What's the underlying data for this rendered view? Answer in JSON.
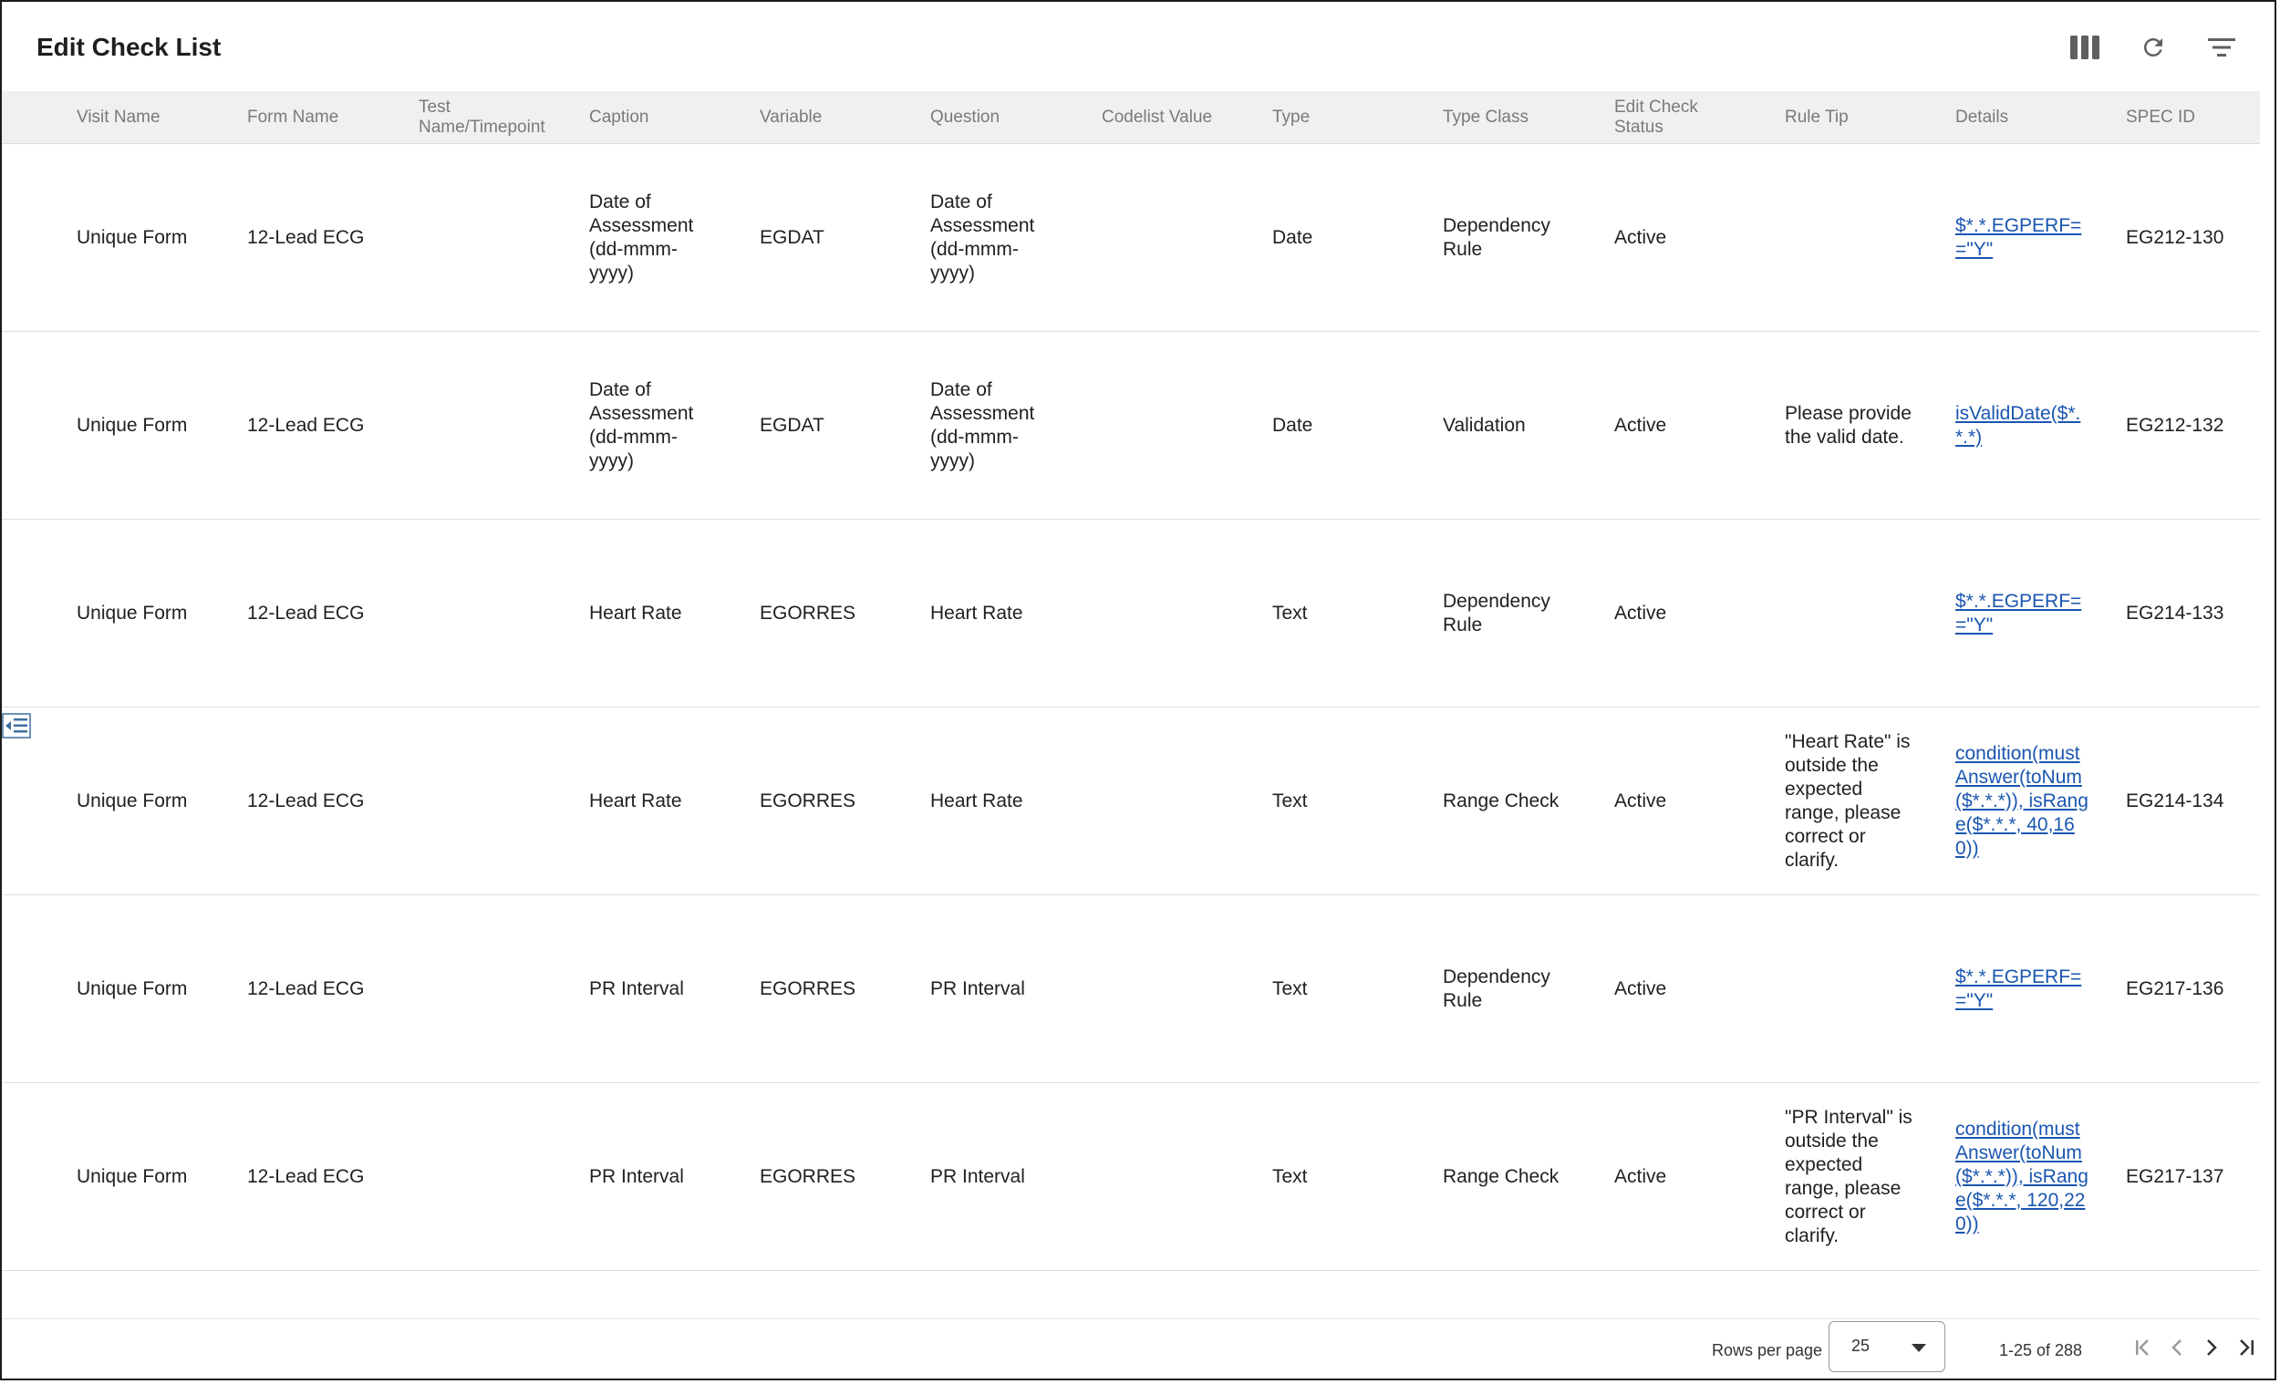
{
  "header": {
    "title": "Edit Check List"
  },
  "toolbar": {
    "columns_icon": "columns-icon",
    "refresh_icon": "refresh-icon",
    "filter_icon": "filter-icon"
  },
  "table": {
    "columns": [
      "Visit Name",
      "Form Name",
      "Test Name/Timepoint",
      "Caption",
      "Variable",
      "Question",
      "Codelist Value",
      "Type",
      "Type Class",
      "Edit Check Status",
      "Rule Tip",
      "Details",
      "SPEC ID"
    ],
    "rows": [
      {
        "visit_name": "Unique Form",
        "form_name": "12-Lead ECG",
        "test_name": "",
        "caption": "Date of Assessment (dd-mmm-yyyy)",
        "variable": "EGDAT",
        "question": "Date of Assessment (dd-mmm-yyyy)",
        "codelist_value": "",
        "type": "Date",
        "type_class": "Dependency Rule",
        "status": "Active",
        "rule_tip": "",
        "details": "$*.*.EGPERF==\"Y\"",
        "spec_id": "EG212-130"
      },
      {
        "visit_name": "Unique Form",
        "form_name": "12-Lead ECG",
        "test_name": "",
        "caption": "Date of Assessment (dd-mmm-yyyy)",
        "variable": "EGDAT",
        "question": "Date of Assessment (dd-mmm-yyyy)",
        "codelist_value": "",
        "type": "Date",
        "type_class": "Validation",
        "status": "Active",
        "rule_tip": "Please provide the valid date.",
        "details": "isValidDate($*.*.*)",
        "spec_id": "EG212-132"
      },
      {
        "visit_name": "Unique Form",
        "form_name": "12-Lead ECG",
        "test_name": "",
        "caption": "Heart Rate",
        "variable": "EGORRES",
        "question": "Heart Rate",
        "codelist_value": "",
        "type": "Text",
        "type_class": "Dependency Rule",
        "status": "Active",
        "rule_tip": "",
        "details": "$*.*.EGPERF==\"Y\"",
        "spec_id": "EG214-133"
      },
      {
        "visit_name": "Unique Form",
        "form_name": "12-Lead ECG",
        "test_name": "",
        "caption": "Heart Rate",
        "variable": "EGORRES",
        "question": "Heart Rate",
        "codelist_value": "",
        "type": "Text",
        "type_class": "Range Check",
        "status": "Active",
        "rule_tip": "\"Heart Rate\" is outside the expected range, please correct or clarify.",
        "details": "condition(mustAnswer(toNum($*.*.*)), isRange($*.*.*, 40,160))",
        "spec_id": "EG214-134"
      },
      {
        "visit_name": "Unique Form",
        "form_name": "12-Lead ECG",
        "test_name": "",
        "caption": "PR Interval",
        "variable": "EGORRES",
        "question": "PR Interval",
        "codelist_value": "",
        "type": "Text",
        "type_class": "Dependency Rule",
        "status": "Active",
        "rule_tip": "",
        "details": "$*.*.EGPERF==\"Y\"",
        "spec_id": "EG217-136"
      },
      {
        "visit_name": "Unique Form",
        "form_name": "12-Lead ECG",
        "test_name": "",
        "caption": "PR Interval",
        "variable": "EGORRES",
        "question": "PR Interval",
        "codelist_value": "",
        "type": "Text",
        "type_class": "Range Check",
        "status": "Active",
        "rule_tip": "\"PR Interval\" is outside the expected range, please correct or clarify.",
        "details": "condition(mustAnswer(toNum($*.*.*)), isRange($*.*.*, 120,220))",
        "spec_id": "EG217-137"
      }
    ]
  },
  "footer": {
    "rows_per_page_label": "Rows per page",
    "rows_per_page_value": "25",
    "range_text": "1-25 of 288"
  },
  "icons": {
    "side_handle": "expand-panel-icon",
    "first_page": "first-page-icon",
    "prev_page": "chevron-left-icon",
    "next_page": "chevron-right-icon",
    "last_page": "last-page-icon",
    "dropdown": "caret-down-icon"
  }
}
